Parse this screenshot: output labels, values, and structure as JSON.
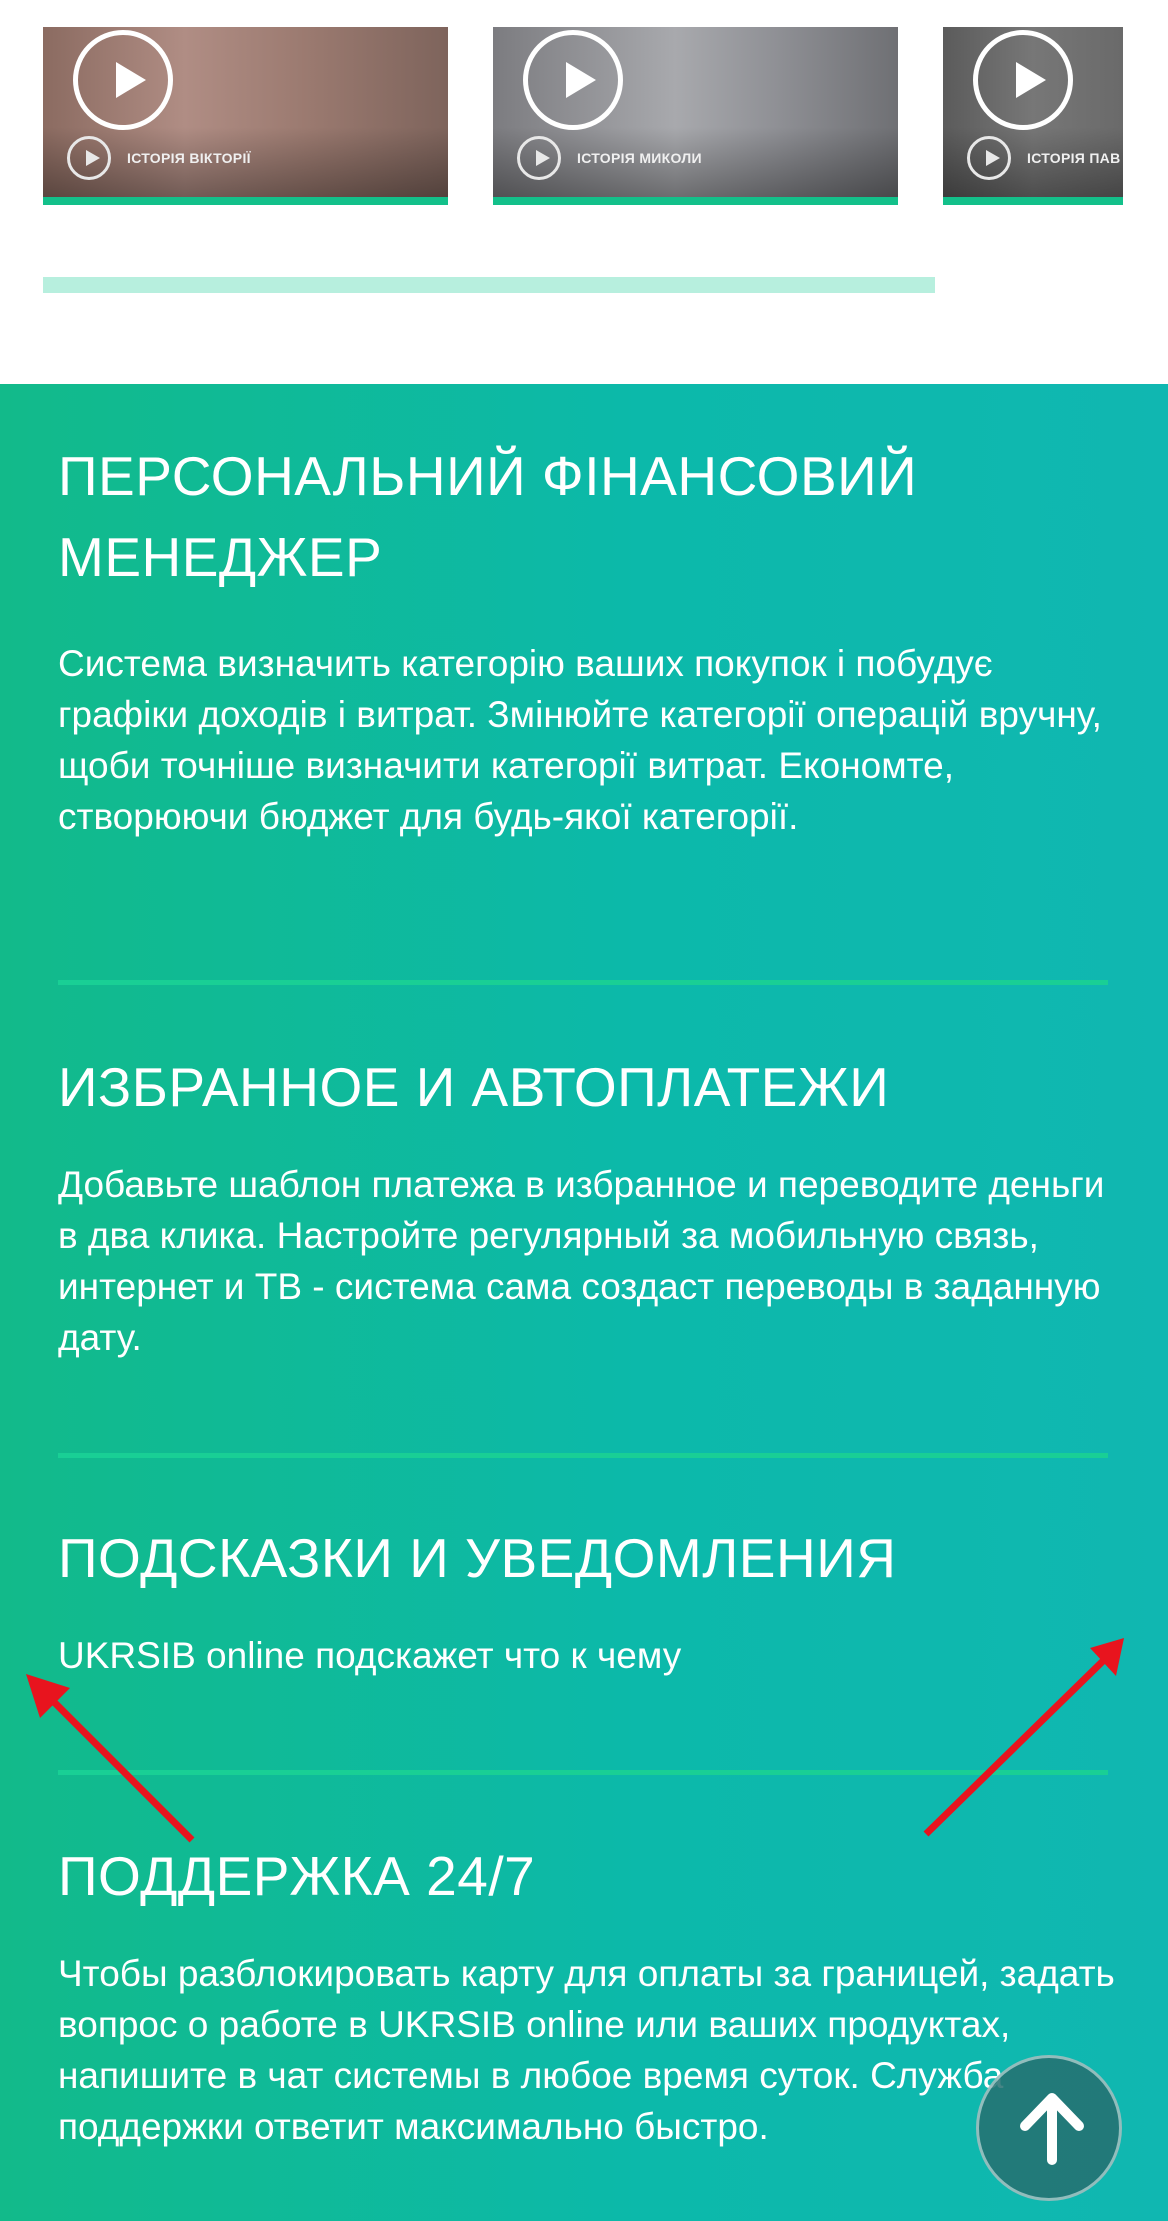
{
  "carousel": {
    "videos": [
      {
        "caption": "ІСТОРІЯ ВІКТОРІЇ"
      },
      {
        "caption": "ІСТОРІЯ МИКОЛИ"
      },
      {
        "caption": "ІСТОРІЯ ПАВ"
      }
    ],
    "icons": {
      "play": "play-icon"
    }
  },
  "features": [
    {
      "title": "ПЕРСОНАЛЬНИЙ ФІНАНСОВИЙ МЕНЕДЖЕР",
      "description": "Система визначить категорію ваших покупок і побудує графіки доходів і витрат. Змінюйте категорії операцій вручну, щоби точніше визначити категорії витрат. Економте, створюючи бюджет для будь-якої категорії."
    },
    {
      "title": "ИЗБРАННОЕ И АВТОПЛАТЕЖИ",
      "description": "Добавьте шаблон платежа в избранное и переводите деньги в два клика. Настройте регулярный за мобильную связь, интернет и ТВ - система сама создаст переводы в заданную дату."
    },
    {
      "title": "ПОДСКАЗКИ И УВЕДОМЛЕНИЯ",
      "description": "UKRSIB online подскажет что к чему"
    },
    {
      "title": "ПОДДЕРЖКА 24/7",
      "description": "Чтобы разблокировать карту для оплаты за границей, задать вопрос о работе в UKRSIB online или ваших продуктах, напишите в чат системы в любое время суток. Служба поддержки ответит максимально быстро."
    }
  ],
  "colors": {
    "brand_green": "#13c08a",
    "section_gradient_start": "#12ba8a",
    "section_gradient_end": "#10b7b1",
    "annotation_arrow": "#e8141e"
  },
  "overlay": {
    "scroll_top_icon": "arrow-up-icon"
  }
}
